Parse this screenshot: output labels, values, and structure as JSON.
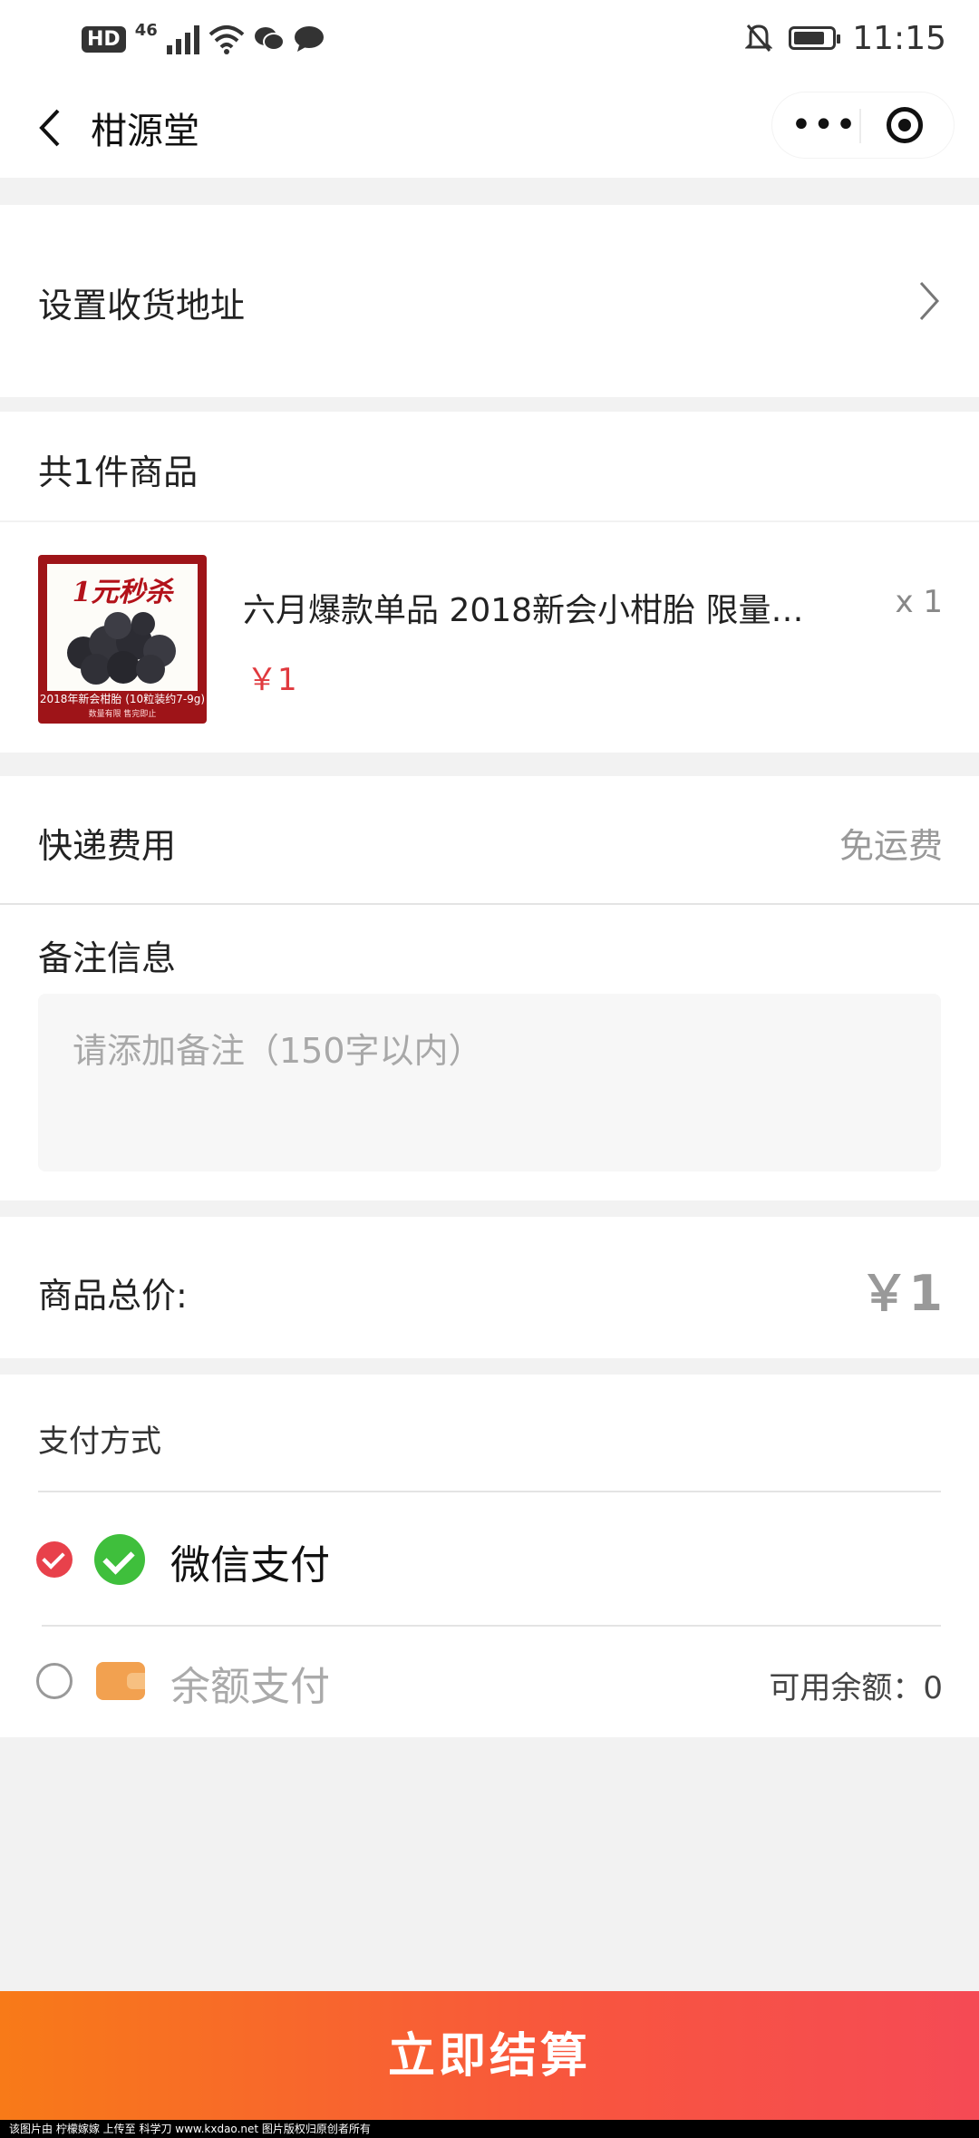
{
  "status_bar": {
    "hd": "HD",
    "network": "46",
    "time": "11:15"
  },
  "nav": {
    "title": "柑源堂",
    "more_label": "•••"
  },
  "address": {
    "label": "设置收货地址"
  },
  "order": {
    "count_label": "共1件商品",
    "item": {
      "image_title": "1元秒杀",
      "image_caption": "2018年新会柑胎 (10粒装约7-9g)",
      "image_sub": "数量有限 售完即止",
      "name": "六月爆款单品 2018新会小柑胎 限量…",
      "price": "￥1",
      "quantity": "x 1"
    }
  },
  "shipping": {
    "label": "快递费用",
    "value": "免运费"
  },
  "note": {
    "label": "备注信息",
    "placeholder": "请添加备注（150字以内）"
  },
  "total": {
    "label": "商品总价:",
    "value": "￥1"
  },
  "payment": {
    "label": "支付方式",
    "options": [
      {
        "name": "微信支付",
        "selected": true,
        "icon": "wechat-pay-icon"
      },
      {
        "name": "余额支付",
        "selected": false,
        "icon": "wallet-icon"
      }
    ],
    "balance": "可用余额：0"
  },
  "checkout": {
    "label": "立即结算"
  },
  "watermark": "该图片由 柠檬嫁嫁 上传至 科学刀 www.kxdao.net 图片版权归原创者所有",
  "colors": {
    "accent_red": "#e8414b",
    "wechat_green": "#3fbf3c",
    "checkout_start": "#f87a18",
    "checkout_end": "#f54a55"
  }
}
